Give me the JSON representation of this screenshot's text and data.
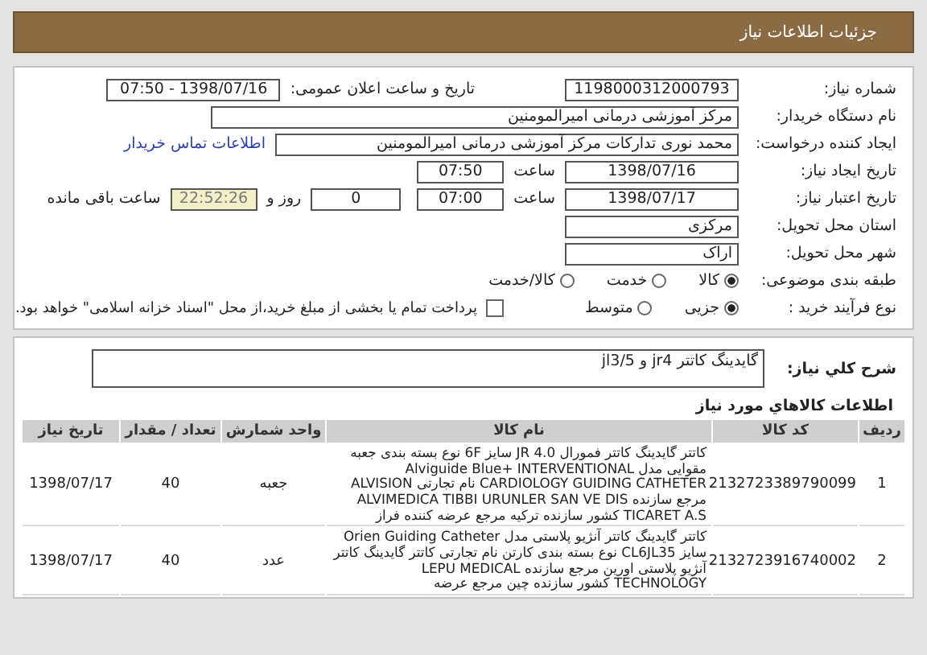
{
  "header": {
    "title": "جزئیات اطلاعات نیاز"
  },
  "details": {
    "need_number": {
      "label": "شماره نیاز:",
      "value": "1198000312000793"
    },
    "announce": {
      "label": "تاریخ و ساعت اعلان عمومی:",
      "value": "1398/07/16 - 07:50"
    },
    "buyer": {
      "label": "نام دستگاه خریدار:",
      "value": "مرکز آموزشی درمانی امیرالمومنین"
    },
    "creator": {
      "label": "ایجاد کننده درخواست:",
      "value": "محمد نوری تدارکات مرکز آموزشی درمانی امیرالمومنین",
      "link": "اطلاعات تماس خریدار"
    },
    "created": {
      "label": "تاریخ ایجاد نیاز:",
      "date": "1398/07/16",
      "time_label": "ساعت",
      "time": "07:50"
    },
    "validity": {
      "label": "تاریخ اعتبار نیاز:",
      "date": "1398/07/17",
      "time_label": "ساعت",
      "time": "07:00",
      "days": "0",
      "days_label": "روز و",
      "remaining": "22:52:26",
      "remaining_label": "ساعت باقی مانده"
    },
    "province": {
      "label": "استان محل تحویل:",
      "value": "مرکزی"
    },
    "city": {
      "label": "شهر محل تحویل:",
      "value": "اراک"
    },
    "category": {
      "label": "طبقه بندی موضوعی:",
      "options": [
        {
          "label": "کالا",
          "selected": true
        },
        {
          "label": "خدمت",
          "selected": false
        },
        {
          "label": "کالا/خدمت",
          "selected": false
        }
      ]
    },
    "process": {
      "label": "نوع فرآیند خرید :",
      "options": [
        {
          "label": "جزیی",
          "selected": true
        },
        {
          "label": "متوسط",
          "selected": false
        }
      ],
      "payment": {
        "checked": false,
        "text": "پرداخت تمام یا بخشی از مبلغ خرید،از محل \"اسناد خزانه اسلامی\" خواهد بود."
      }
    }
  },
  "summary": {
    "label": "شرح کلي نياز:",
    "value": "گایدینگ کاتتر jr4 و jl3/5"
  },
  "items": {
    "title": "اطلاعات کالاهاي مورد نياز",
    "columns": [
      "ردیف",
      "کد کالا",
      "نام کالا",
      "واحد شمارش",
      "تعداد / مقدار",
      "تاریخ نیاز"
    ],
    "rows": [
      [
        "1",
        "2132723389790099",
        "کاتتر گایدینگ کاتتر فمورال JR 4.0 سایز 6F نوع بسته بندی جعبه مقوایی مدل Alviguide Blue+ INTERVENTIONAL CARDIOLOGY GUIDING CATHETER نام تجارتی ALVISION مرجع سازنده ALVIMEDICA TIBBI URUNLER SAN VE DIS TICARET A.S کشور سازنده ترکیه مرجع عرضه کننده فراز",
        "جعبه",
        "40",
        "1398/07/17"
      ],
      [
        "2",
        "2132723916740002",
        "کاتتر گایدینگ کاتتر آنژیو پلاستی مدل Orien Guiding Catheter سایز CL6JL35 نوع بسته بندی کارتن نام تجارتی کاتتر گایدینگ کاتتر آنژیو پلاستی اورین مرجع سازنده LEPU MEDICAL TECHNOLOGY کشور سازنده چین مرجع عرضه",
        "عدد",
        "40",
        "1398/07/17"
      ]
    ]
  }
}
